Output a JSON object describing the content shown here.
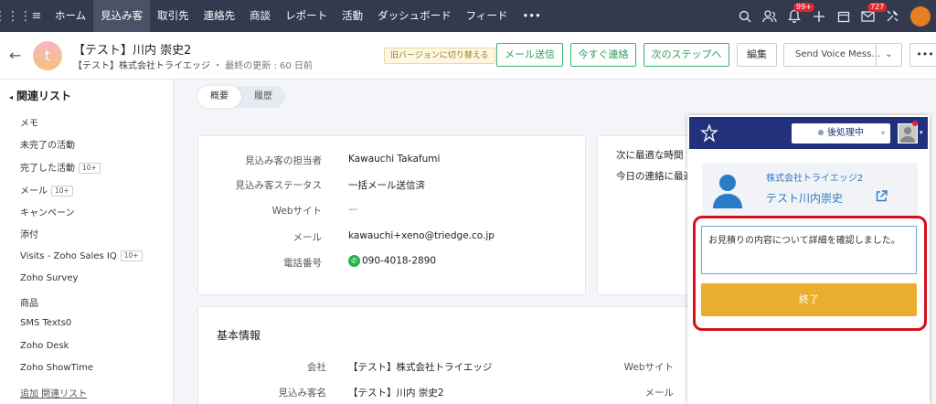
{
  "topbar": {
    "nav": [
      "ホーム",
      "見込み客",
      "取引先",
      "連絡先",
      "商談",
      "レポート",
      "活動",
      "ダッシュボード",
      "フィード",
      "•••"
    ],
    "active_index": 1,
    "notification_badge": "99+",
    "mail_badge": "727"
  },
  "record": {
    "avatar_letter": "t",
    "title": "【テスト】川内 崇史2",
    "company": "【テスト】株式会社トライエッジ",
    "separator": "・",
    "updated": "最終の更新 : 60 日前",
    "old_version_label": "旧バージョンに切り替える",
    "actions": {
      "send_mail": "メール送信",
      "contact_now": "今すぐ連絡",
      "next_step": "次のステップへ",
      "edit": "編集",
      "send_voice": "Send Voice Mess...",
      "more": "•••"
    }
  },
  "sidebar": {
    "title": "関連リスト",
    "items": [
      {
        "label": "メモ",
        "count": ""
      },
      {
        "label": "未完了の活動",
        "count": ""
      },
      {
        "label": "完了した活動",
        "count": "10+"
      },
      {
        "label": "メール",
        "count": "10+"
      },
      {
        "label": "キャンペーン",
        "count": ""
      },
      {
        "label": "添付",
        "count": ""
      },
      {
        "label": "Visits - Zoho Sales IQ",
        "count": "10+"
      },
      {
        "label": "Zoho Survey",
        "count": ""
      },
      {
        "label": "商品",
        "count": ""
      },
      {
        "label": "SMS Texts0",
        "count": ""
      },
      {
        "label": "Zoho Desk",
        "count": ""
      },
      {
        "label": "Zoho ShowTime",
        "count": ""
      }
    ],
    "add_link": "追加 関連リスト"
  },
  "tabs": [
    "概要",
    "履歴"
  ],
  "summary": {
    "fields": [
      {
        "label": "見込み客の担当者",
        "value": "Kawauchi Takafumi"
      },
      {
        "label": "見込み客ステータス",
        "value": "一括メール送信済"
      },
      {
        "label": "Webサイト",
        "value": "—"
      },
      {
        "label": "メール",
        "value": "kawauchi+xeno@triedge.co.jp"
      },
      {
        "label": "電話番号",
        "value": "090-4018-2890"
      }
    ],
    "best_time_label": "次に最適な時間",
    "best_time_value": "今日の連絡に最適"
  },
  "basic_info": {
    "title": "基本情報",
    "company_label": "会社",
    "company_value": "【テスト】株式会社トライエッジ",
    "name_label": "見込み客名",
    "name_value": "【テスト】川内 崇史2",
    "website_label": "Webサイト",
    "mail_label": "メール"
  },
  "call_panel": {
    "status": "後処理中",
    "company": "株式会社トライエッジ2",
    "name": "テスト川内崇史",
    "memo": "お見積りの内容について詳細を確認しました。",
    "end_label": "終了"
  },
  "colors": {
    "topbar": "#343a4e",
    "accent_green": "#3cb371",
    "panel_header": "#23317c",
    "end_button": "#e9ae2e",
    "highlight": "#d4101c"
  }
}
